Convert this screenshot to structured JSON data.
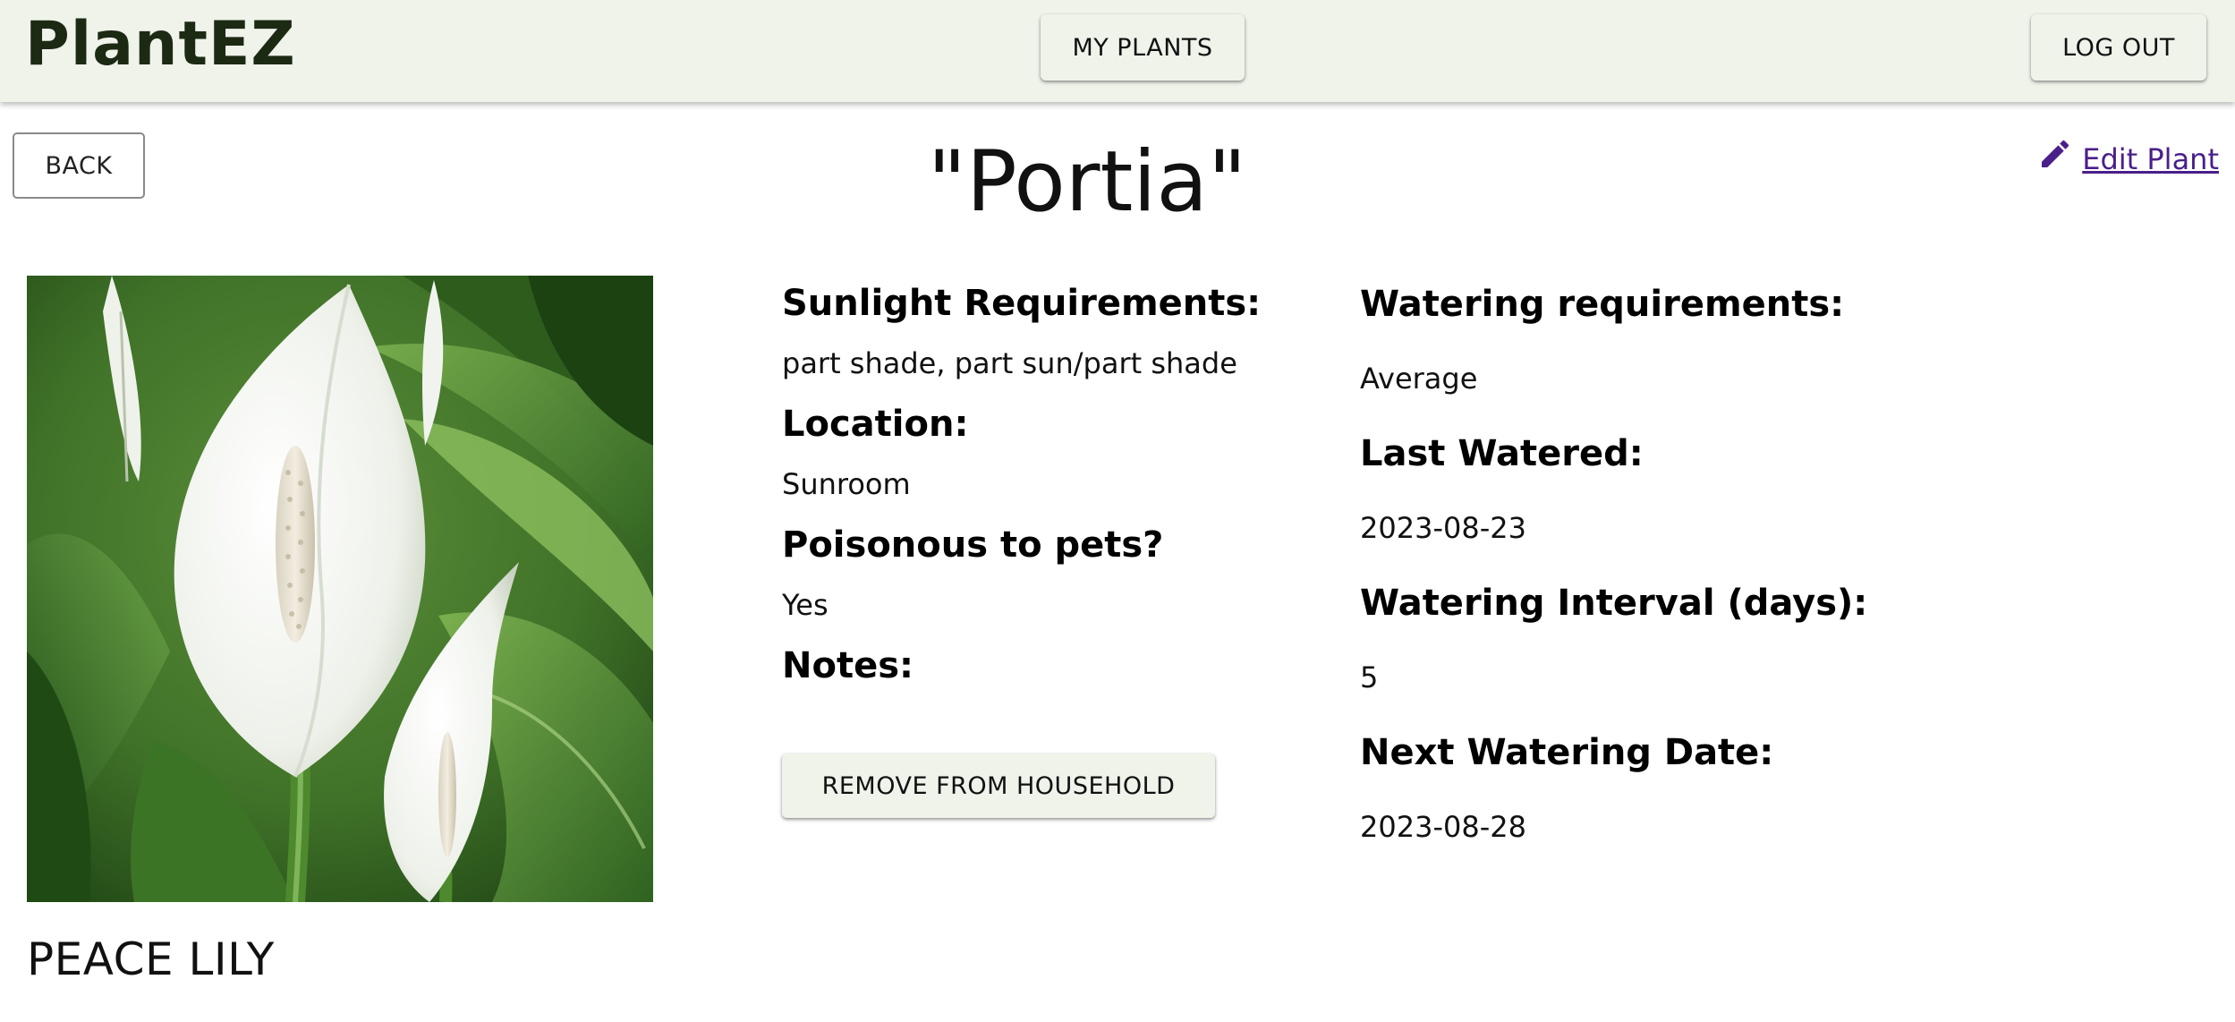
{
  "header": {
    "brand": "PlantEZ",
    "my_plants_label": "MY PLANTS",
    "logout_label": "LOG OUT",
    "background_color": "#eff3ea"
  },
  "page": {
    "back_label": "BACK",
    "plant_nickname": "\"Portia\"",
    "edit_label": " Edit Plant",
    "edit_icon": "pencil-icon",
    "species_name": "PEACE LILY",
    "photo_description_icon": "peace-lily-photo"
  },
  "details": {
    "sunlight_label": "Sunlight Requirements:",
    "sunlight_value": "part shade, part sun/part shade",
    "location_label": "Location:",
    "location_value": "Sunroom",
    "poisonous_label": "Poisonous to pets?",
    "poisonous_value": "Yes",
    "notes_label": "Notes:",
    "notes_value": "",
    "remove_label": "REMOVE FROM HOUSEHOLD"
  },
  "watering": {
    "requirements_label": "Watering requirements:",
    "requirements_value": "Average",
    "last_watered_label": "Last Watered:",
    "last_watered_value": "2023-08-23",
    "interval_label": "Watering Interval (days):",
    "interval_value": "5",
    "next_date_label": "Next Watering Date:",
    "next_date_value": "2023-08-28"
  },
  "colors": {
    "link": "#4a1f8a",
    "brand_text": "#1c2a14"
  }
}
